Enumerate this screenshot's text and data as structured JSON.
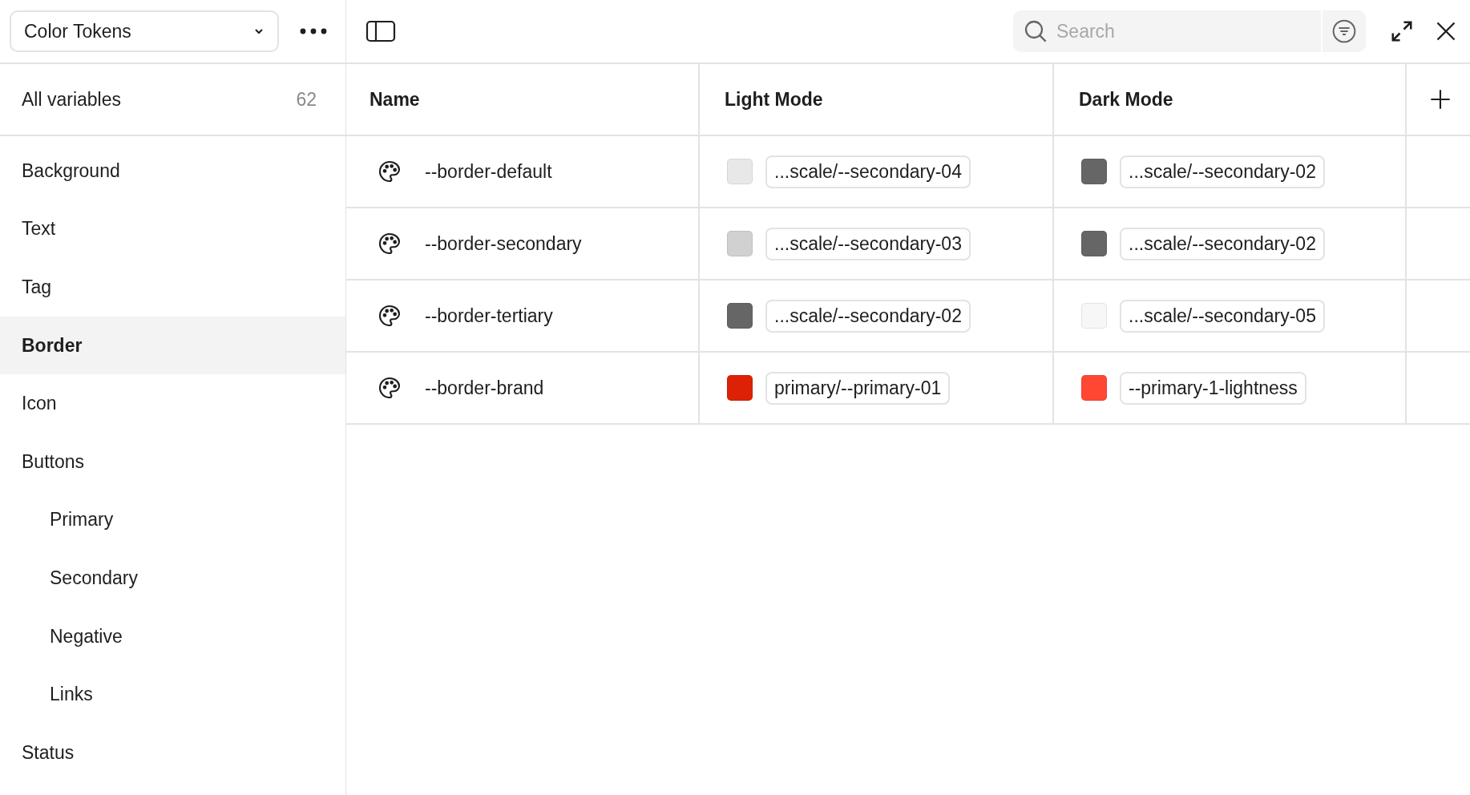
{
  "collection_select": {
    "value": "Color Tokens"
  },
  "all_variables": {
    "label": "All variables",
    "count": "62",
    "selected": false
  },
  "groups": [
    {
      "label": "Background",
      "selected": false
    },
    {
      "label": "Text",
      "selected": false
    },
    {
      "label": "Tag",
      "selected": false
    },
    {
      "label": "Border",
      "selected": true
    },
    {
      "label": "Icon",
      "selected": false
    },
    {
      "label": "Buttons",
      "selected": false,
      "children": [
        {
          "label": "Primary",
          "selected": false
        },
        {
          "label": "Secondary",
          "selected": false
        },
        {
          "label": "Negative",
          "selected": false
        },
        {
          "label": "Links",
          "selected": false
        }
      ]
    },
    {
      "label": "Status",
      "selected": false
    }
  ],
  "search": {
    "placeholder": "Search"
  },
  "table": {
    "columns": [
      "Name",
      "Light Mode",
      "Dark Mode"
    ],
    "rows": [
      {
        "name": "--border-default",
        "light": {
          "color": "#e8e8e8",
          "value": "...scale/--secondary-04"
        },
        "dark": {
          "color": "#666666",
          "value": "...scale/--secondary-02"
        }
      },
      {
        "name": "--border-secondary",
        "light": {
          "color": "#d1d1d1",
          "value": "...scale/--secondary-03"
        },
        "dark": {
          "color": "#666666",
          "value": "...scale/--secondary-02"
        }
      },
      {
        "name": "--border-tertiary",
        "light": {
          "color": "#666666",
          "value": "...scale/--secondary-02"
        },
        "dark": {
          "color": "#f7f7f7",
          "value": "...scale/--secondary-05"
        }
      },
      {
        "name": "--border-brand",
        "light": {
          "color": "#dc2106",
          "value": "primary/--primary-01"
        },
        "dark": {
          "color": "#ff4733",
          "value": "--primary-1-lightness"
        }
      }
    ]
  }
}
